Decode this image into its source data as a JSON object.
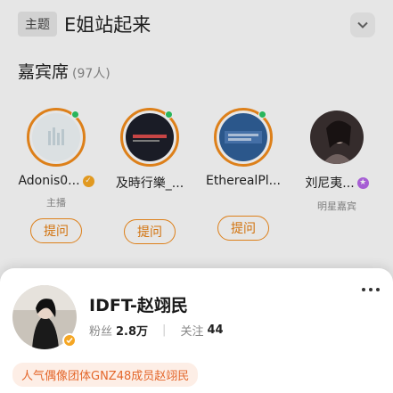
{
  "topic": {
    "tag": "主题",
    "title": "E姐站起来"
  },
  "guests_section": {
    "title": "嘉宾席",
    "count": "(97人)"
  },
  "guests": [
    {
      "name": "Adonis0...",
      "role": "主播",
      "ask": "提问",
      "badge_color": "#f5a623"
    },
    {
      "name": "及時行樂_...",
      "role": "",
      "ask": "提问"
    },
    {
      "name": "EtherealPl...",
      "role": "",
      "ask": "提问"
    },
    {
      "name": "刘尼夷...",
      "role": "明星嘉宾",
      "badge_color": "#b566e6"
    }
  ],
  "profile": {
    "name": "IDFT-赵翊民",
    "fans_label": "粉丝",
    "fans_value": "2.8万",
    "separator": "|",
    "follow_label": "关注",
    "follow_value": "44",
    "bio": "人气偶像团体GNZ48成员赵翊民"
  },
  "colors": {
    "accent": "#f08b1d",
    "online": "#2dc563",
    "bio_text": "#e4672b"
  }
}
